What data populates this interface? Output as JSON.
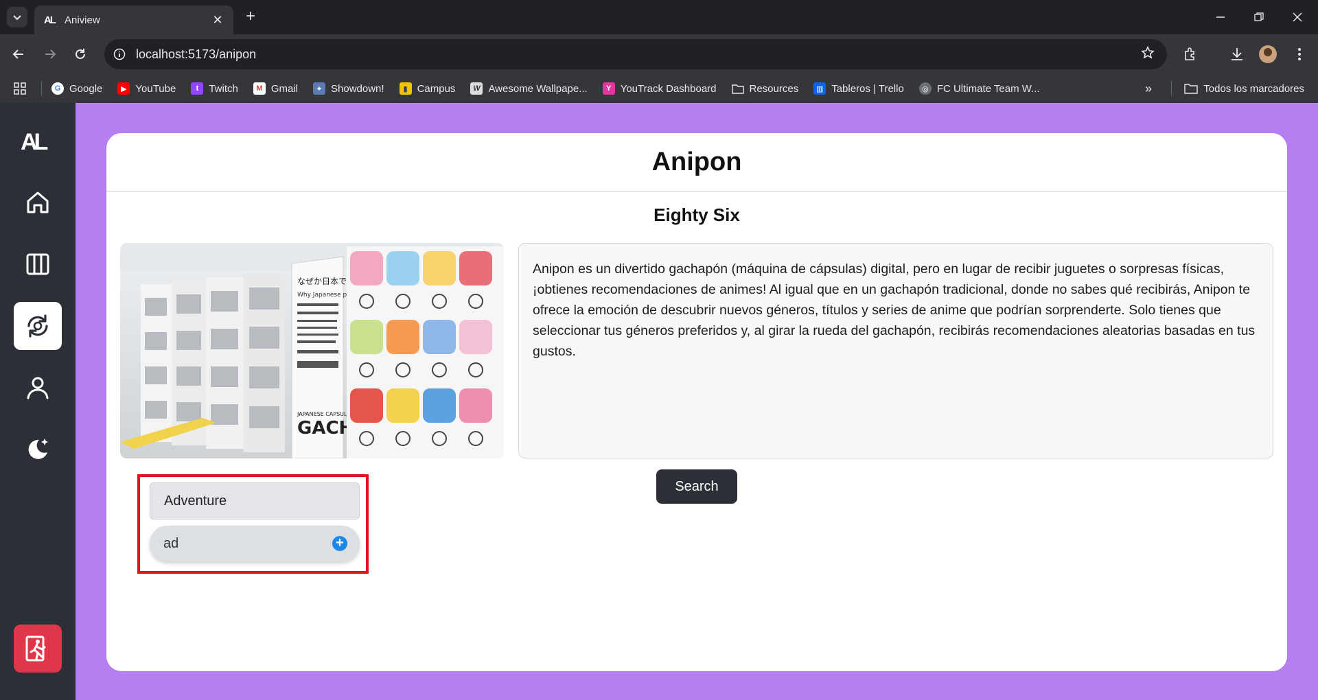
{
  "browser": {
    "tab_title": "Aniview",
    "tab_favicon": "AL",
    "url": "localhost:5173/anipon",
    "bookmarks": [
      {
        "label": "Google",
        "icon": "google-icon"
      },
      {
        "label": "YouTube",
        "icon": "youtube-icon"
      },
      {
        "label": "Twitch",
        "icon": "twitch-icon"
      },
      {
        "label": "Gmail",
        "icon": "gmail-icon"
      },
      {
        "label": "Showdown!",
        "icon": "showdown-icon"
      },
      {
        "label": "Campus",
        "icon": "campus-icon"
      },
      {
        "label": "Awesome Wallpape...",
        "icon": "wallpaper-icon"
      },
      {
        "label": "YouTrack Dashboard",
        "icon": "youtrack-icon"
      },
      {
        "label": "Resources",
        "icon": "folder-icon"
      },
      {
        "label": "Tableros | Trello",
        "icon": "trello-icon"
      },
      {
        "label": "FC Ultimate Team W...",
        "icon": "globe-icon"
      }
    ],
    "all_bookmarks_label": "Todos los marcadores"
  },
  "sidebar": {
    "logo": "AL",
    "items": [
      {
        "name": "home",
        "icon": "home-icon",
        "active": false
      },
      {
        "name": "library",
        "icon": "library-icon",
        "active": false
      },
      {
        "name": "anipon",
        "icon": "gacha-refresh-icon",
        "active": true
      },
      {
        "name": "profile",
        "icon": "user-icon",
        "active": false
      },
      {
        "name": "theme",
        "icon": "theme-icon",
        "active": false
      }
    ],
    "exit_icon": "exit-icon"
  },
  "page": {
    "title": "Anipon",
    "subtitle": "Eighty Six",
    "description": "Anipon es un divertido gachapón (máquina de cápsulas) digital, pero en lugar de recibir juguetes o sorpresas físicas, ¡obtienes recomendaciones de animes! Al igual que en un gachapón tradicional, donde no sabes qué recibirás, Anipon te ofrece la emoción de descubrir nuevos géneros, títulos y series de anime que podrían sorprenderte. Solo tienes que seleccionar tus géneros preferidos y, al girar la rueda del gachapón, recibirás recomendaciones aleatorias basadas en tus gustos.",
    "search_label": "Search",
    "genres": [
      "Adventure"
    ],
    "genre_input_value": "ad",
    "photo_text": {
      "jp_line1": "なぜか日本で売れてます。",
      "en_line": "Why Japanese people like this!",
      "gacha": "GACHA",
      "capsule": "JAPANESE CAPSULE TOY"
    }
  },
  "colors": {
    "app_bg": "#b57ff2",
    "sidebar_bg": "#2c3036",
    "exit_bg": "#e0364c",
    "highlight_border": "#e0161c",
    "add_icon": "#1e88e5"
  }
}
